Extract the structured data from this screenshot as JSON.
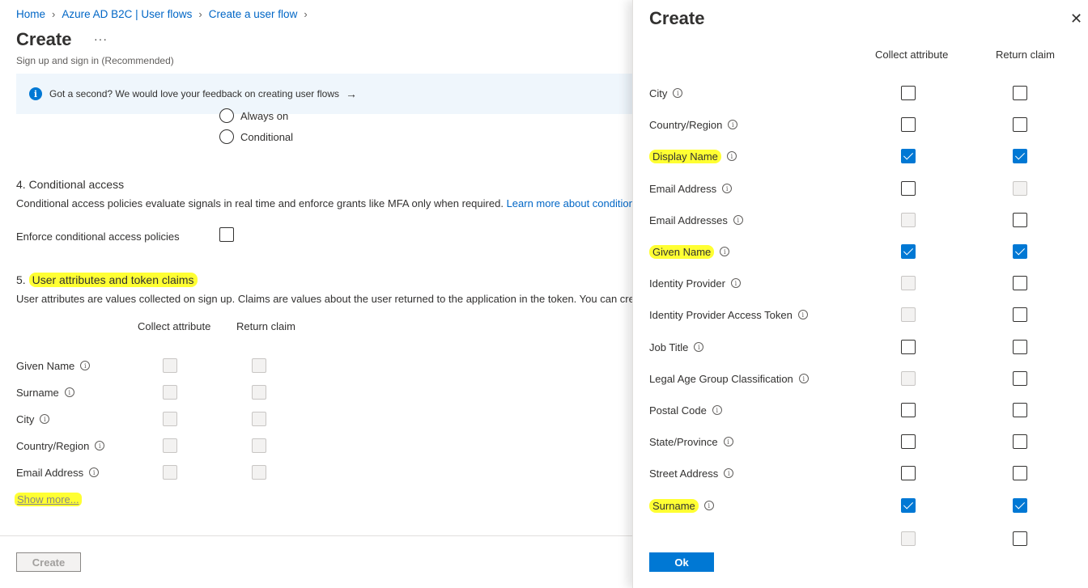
{
  "breadcrumb": [
    "Home",
    "Azure AD B2C | User flows",
    "Create a user flow"
  ],
  "page": {
    "title": "Create",
    "subtitle": "Sign up and sign in (Recommended)"
  },
  "feedback": {
    "text": "Got a second? We would love your feedback on creating user flows"
  },
  "mfa_options": [
    "Always on",
    "Conditional"
  ],
  "conditional_access": {
    "heading": "4. Conditional access",
    "description": "Conditional access policies evaluate signals in real time and enforce grants like MFA only when required. ",
    "link": "Learn more about conditional access",
    "enforce_label": "Enforce conditional access policies"
  },
  "user_attributes": {
    "heading_number": "5. ",
    "heading_text": "User attributes and token claims",
    "description": "User attributes are values collected on sign up. Claims are values about the user returned to the application in the token. You can create custom attributes.",
    "col_collect": "Collect attribute",
    "col_return": "Return claim",
    "rows": [
      {
        "label": "Given Name"
      },
      {
        "label": "Surname"
      },
      {
        "label": "City"
      },
      {
        "label": "Country/Region"
      },
      {
        "label": "Email Address"
      }
    ],
    "show_more": "Show more..."
  },
  "footer": {
    "create_label": "Create"
  },
  "panel": {
    "title": "Create",
    "col_collect": "Collect attribute",
    "col_return": "Return claim",
    "rows": [
      {
        "label": "City",
        "collect": "unchecked",
        "ret": "unchecked",
        "highlight": false
      },
      {
        "label": "Country/Region",
        "collect": "unchecked",
        "ret": "unchecked",
        "highlight": false
      },
      {
        "label": "Display Name",
        "collect": "checked",
        "ret": "checked",
        "highlight": true
      },
      {
        "label": "Email Address",
        "collect": "unchecked",
        "ret": "disabled",
        "highlight": false
      },
      {
        "label": "Email Addresses",
        "collect": "disabled",
        "ret": "unchecked",
        "highlight": false
      },
      {
        "label": "Given Name",
        "collect": "checked",
        "ret": "checked",
        "highlight": true
      },
      {
        "label": "Identity Provider",
        "collect": "disabled",
        "ret": "unchecked",
        "highlight": false
      },
      {
        "label": "Identity Provider Access Token",
        "collect": "disabled",
        "ret": "unchecked",
        "highlight": false
      },
      {
        "label": "Job Title",
        "collect": "unchecked",
        "ret": "unchecked",
        "highlight": false
      },
      {
        "label": "Legal Age Group Classification",
        "collect": "disabled",
        "ret": "unchecked",
        "highlight": false
      },
      {
        "label": "Postal Code",
        "collect": "unchecked",
        "ret": "unchecked",
        "highlight": false
      },
      {
        "label": "State/Province",
        "collect": "unchecked",
        "ret": "unchecked",
        "highlight": false
      },
      {
        "label": "Street Address",
        "collect": "unchecked",
        "ret": "unchecked",
        "highlight": false
      },
      {
        "label": "Surname",
        "collect": "checked",
        "ret": "checked",
        "highlight": true
      }
    ],
    "ok_label": "Ok"
  },
  "colors": {
    "accent": "#0078d4",
    "link": "#0066c6",
    "highlight": "#ffff33",
    "banner": "#eff6fc"
  },
  "icons": {
    "info": "info-circle-icon",
    "more": "ellipsis-icon",
    "close": "close-icon",
    "arrow": "arrow-right-icon",
    "tooltip": "info-tooltip-icon"
  }
}
